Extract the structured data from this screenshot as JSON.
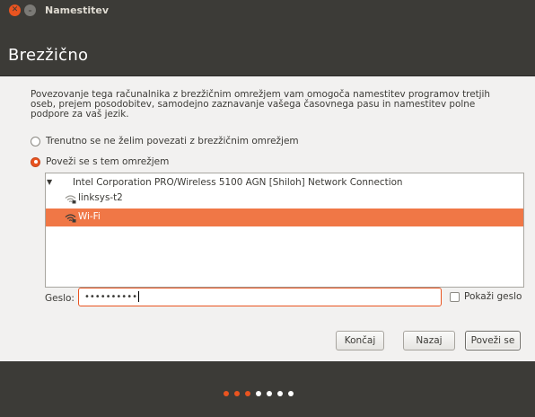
{
  "window": {
    "title": "Namestitev"
  },
  "header": {
    "title": "Brezžično"
  },
  "description": "Povezovanje tega računalnika z brezžičnim omrežjem vam omogoča namestitev programov tretjih oseb, prejem posodobitev, samodejno zaznavanje vašega časovnega pasu in namestitev polne podpore za vaš jezik.",
  "options": [
    {
      "label": "Trenutno se ne želim povezati z brezžičnim omrežjem",
      "checked": false
    },
    {
      "label": "Poveži se s tem omrežjem",
      "checked": true
    }
  ],
  "network_list": {
    "adapter": "Intel Corporation PRO/Wireless 5100 AGN [Shiloh] Network Connection",
    "networks": [
      {
        "ssid": "linksys-t2",
        "selected": false,
        "icon": "wifi-secure-icon"
      },
      {
        "ssid": "Wi-Fi",
        "selected": true,
        "icon": "wifi-secure-icon"
      }
    ]
  },
  "password": {
    "label": "Geslo:",
    "value": "••••••••••"
  },
  "show_password": {
    "label": "Pokaži geslo",
    "checked": false
  },
  "buttons": {
    "quit": "Končaj",
    "back": "Nazaj",
    "connect": "Poveži se"
  },
  "progress": {
    "total_steps": 7,
    "completed_steps": 3
  },
  "colors": {
    "accent": "#e95420",
    "selection": "#f07746",
    "dark": "#3c3b37"
  }
}
